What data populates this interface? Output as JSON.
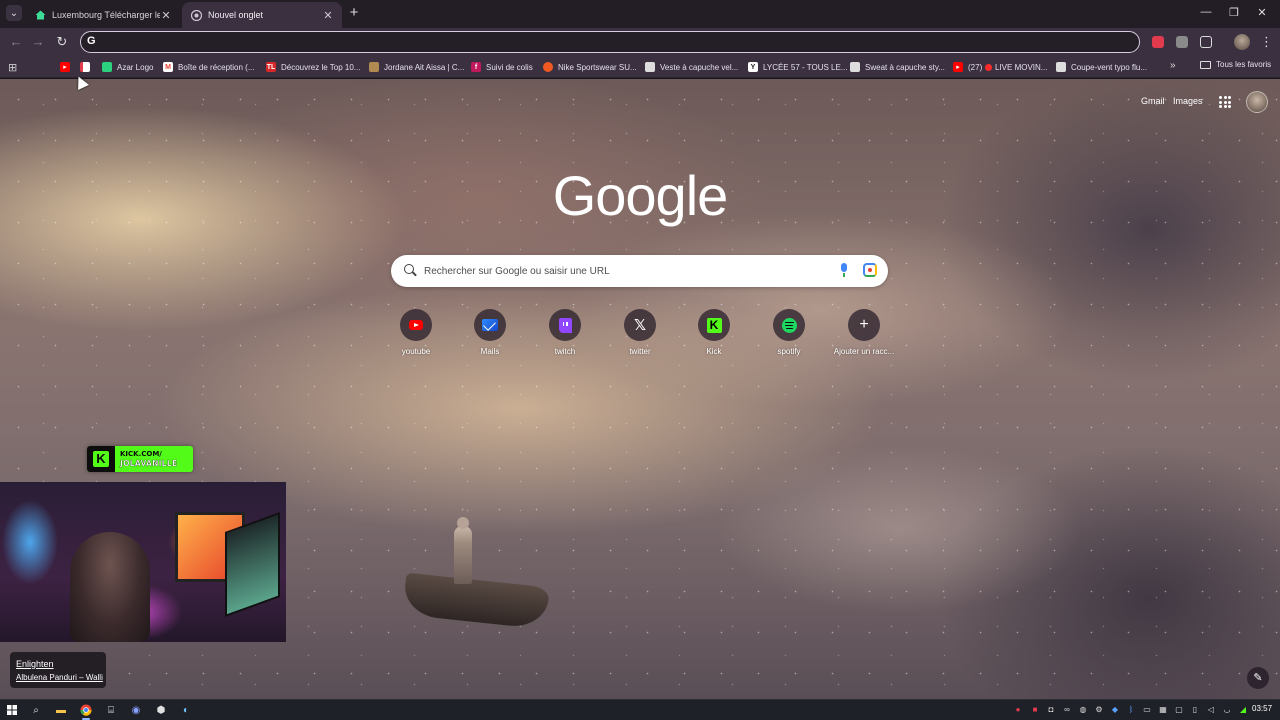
{
  "tabs": [
    {
      "title": "Luxembourg Télécharger le calc",
      "active": false,
      "favicon": "house-icon"
    },
    {
      "title": "Nouvel onglet",
      "active": true,
      "favicon": "chrome-icon"
    }
  ],
  "window_controls": {
    "minimize": "—",
    "restore": "❐",
    "close": "✕"
  },
  "omnibox": {
    "value": "",
    "placeholder": "",
    "prefix": "G"
  },
  "bookmarks": [
    {
      "label": "",
      "icon": "youtube-icon",
      "color": "#ff0000"
    },
    {
      "label": "",
      "icon": "flag-icon",
      "color": "#ffffff"
    },
    {
      "label": "Azar Logo",
      "icon": "azar-icon",
      "color": "#2bd17e"
    },
    {
      "label": "Boîte de réception (...",
      "icon": "gmail-icon",
      "color": "#ea4335"
    },
    {
      "label": "Découvrez le Top 10...",
      "icon": "tl-icon",
      "color": "#d62828"
    },
    {
      "label": "Jordane Ait Aissa | C...",
      "icon": "person-icon",
      "color": "#b08a50"
    },
    {
      "label": "Suivi de colis",
      "icon": "parcel-icon",
      "color": "#c0185c"
    },
    {
      "label": "Nike Sportswear SU...",
      "icon": "nike-icon",
      "color": "#f05a22"
    },
    {
      "label": "Veste à capuche vel...",
      "icon": "jacket-icon",
      "color": "#dddddd"
    },
    {
      "label": "LYCÉE 57 - TOUS LE...",
      "icon": "y-icon",
      "color": "#ffffff"
    },
    {
      "label": "Sweat à capuche sty...",
      "icon": "sweat-icon",
      "color": "#dddddd"
    },
    {
      "label": "(27)",
      "icon": "youtube-icon",
      "color": "#ff0000"
    },
    {
      "label": "LIVE MOVIN...",
      "icon": "live-icon",
      "color": "#ff2a2a"
    },
    {
      "label": "Coupe-vent typo flu...",
      "icon": "windbreaker-icon",
      "color": "#dddddd"
    }
  ],
  "bookmarks_all": "Tous les favoris",
  "ntp": {
    "gmail": "Gmail",
    "images": "Images",
    "logo": "Google",
    "search_placeholder": "Rechercher sur Google ou saisir une URL",
    "shortcuts": [
      {
        "label": "youtube",
        "icon": "youtube-icon"
      },
      {
        "label": "Mails",
        "icon": "mail-icon"
      },
      {
        "label": "twitch",
        "icon": "twitch-icon"
      },
      {
        "label": "twitter",
        "icon": "x-icon"
      },
      {
        "label": "Kick",
        "icon": "kick-icon"
      },
      {
        "label": "spotify",
        "icon": "spotify-icon"
      },
      {
        "label": "Ajouter un racc...",
        "icon": "plus-icon"
      }
    ]
  },
  "stream": {
    "badge_line1": "KICK.COM/",
    "badge_line2": "JOLAVANILLE",
    "song_title": "Enlighten",
    "song_artist": "Albulena Panduri – Walli"
  },
  "taskbar": {
    "clock": "03:57"
  },
  "colors": {
    "accent": "#3a3040",
    "kick": "#53fc18"
  }
}
